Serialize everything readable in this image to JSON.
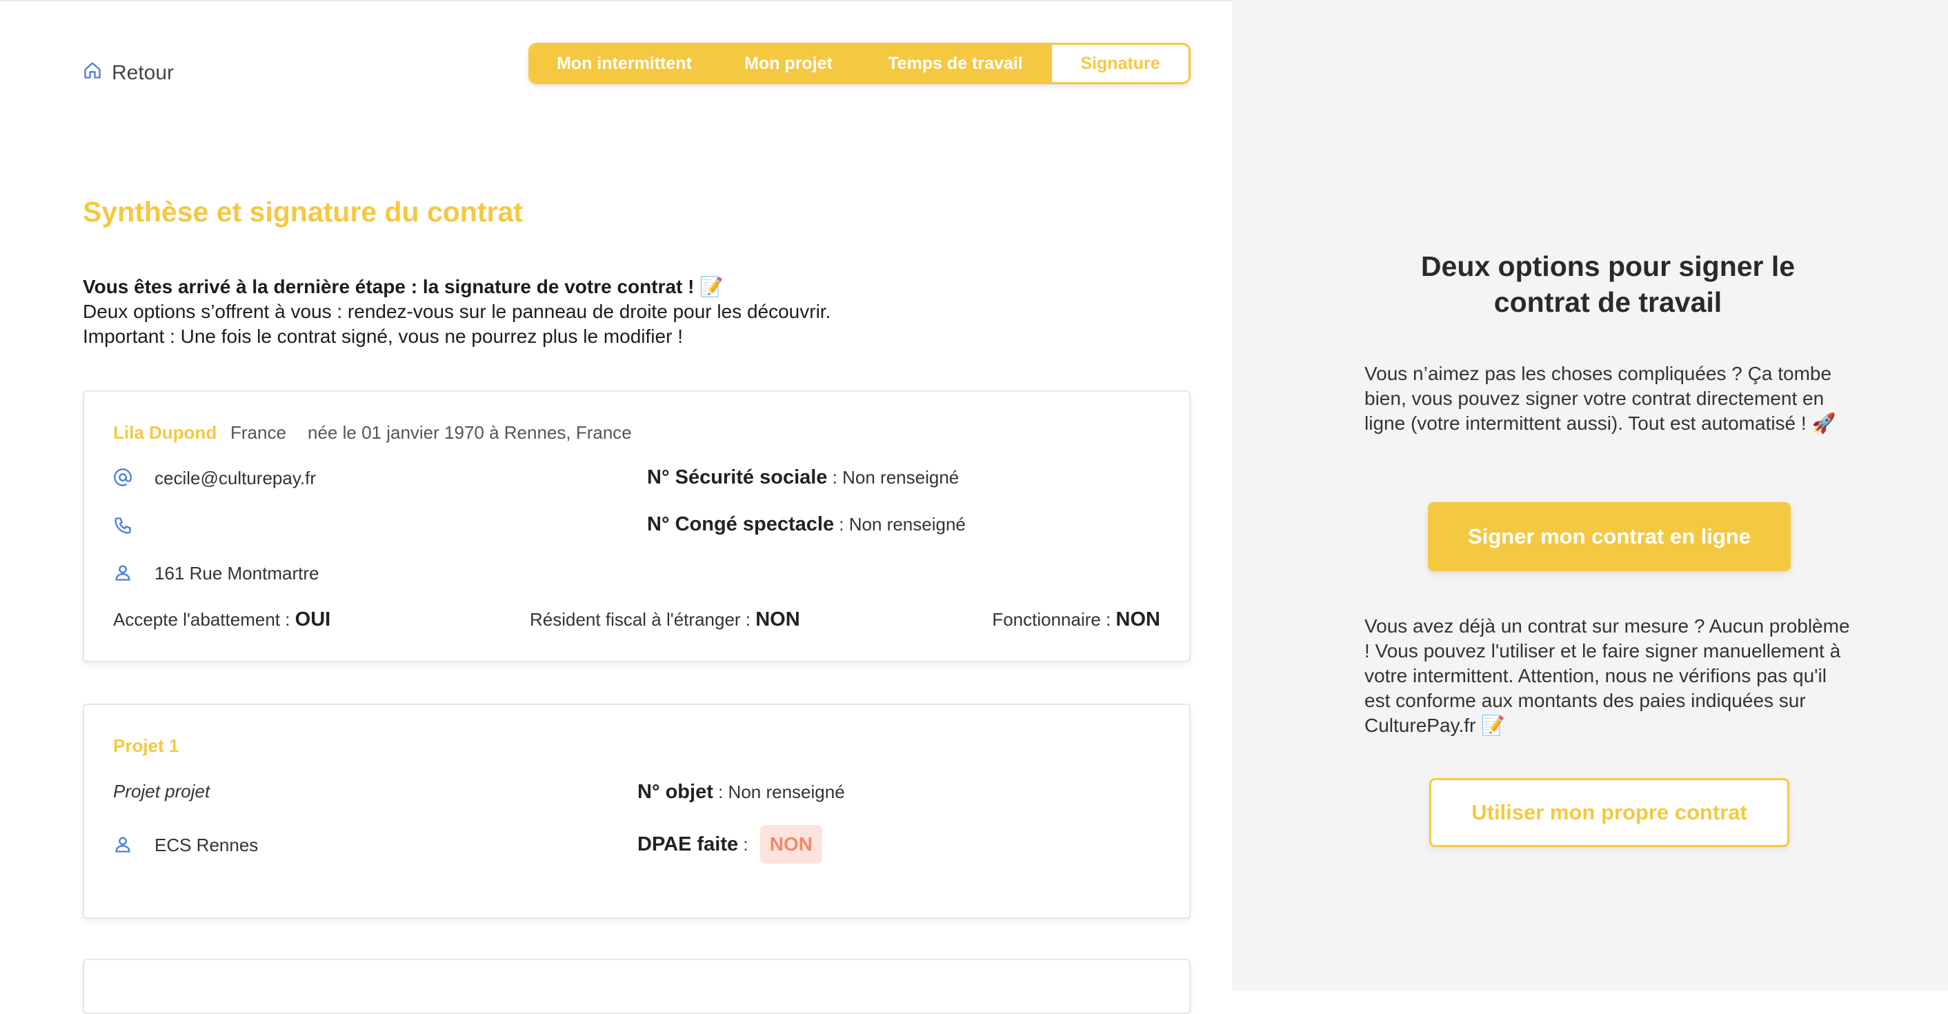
{
  "header": {
    "back_label": "Retour",
    "steps": [
      "Mon intermittent",
      "Mon projet",
      "Temps de travail",
      "Signature"
    ],
    "active_step": "Signature"
  },
  "main": {
    "title": "Synthèse et signature du contrat",
    "intro_bold": "Vous êtes arrivé à la dernière étape : la signature de votre contrat ! 📝",
    "intro_line2": "Deux options s’offrent à vous : rendez-vous sur le panneau de droite pour les découvrir.",
    "intro_line3": "Important : Une fois le contrat signé, vous ne pourrez plus le modifier !"
  },
  "person": {
    "name": "Lila Dupond",
    "country": "France",
    "birth": "née le 01 janvier 1970 à Rennes, France",
    "email": "cecile@culturepay.fr",
    "phone": "",
    "address": "161 Rue Montmartre",
    "ss_label": "N° Sécurité sociale",
    "ss_value": " : Non renseigné",
    "conge_label": "N° Congé spectacle",
    "conge_value": " : Non renseigné",
    "abattement_label": "Accepte l'abattement : ",
    "abattement_value": "OUI",
    "resident_label": "Résident fiscal à l'étranger : ",
    "resident_value": "NON",
    "fonctionnaire_label": "Fonctionnaire : ",
    "fonctionnaire_value": "NON"
  },
  "project": {
    "title": "Projet 1",
    "name": "Projet projet",
    "location": "ECS Rennes",
    "objet_label": "N° objet",
    "objet_value": " : Non renseigné",
    "dpae_label": "DPAE faite",
    "dpae_sep": " : ",
    "dpae_value": "NON"
  },
  "right_panel": {
    "title": "Deux options pour signer le contrat de travail",
    "text_online": "Vous n’aimez pas les choses compliquées ? Ça tombe bien, vous pouvez signer votre contrat directement en ligne (votre intermittent aussi). Tout est automatisé ! 🚀",
    "btn_online": "Signer mon contrat en ligne",
    "text_own": "Vous avez déjà un contrat sur mesure ? Aucun problème ! Vous pouvez l'utiliser et le faire signer manuellement à votre intermittent. Attention, nous ne vérifions pas qu'il est conforme aux montants des paies indiquées sur CulturePay.fr 📝",
    "btn_own": "Utiliser mon propre contrat"
  },
  "colors": {
    "accent": "#f5c842",
    "badge_bg": "#fde3dc",
    "badge_text": "#f08a6e",
    "icon_blue": "#4a7fd6",
    "panel_bg": "#f4f4f4"
  },
  "icons": {
    "back": "home-icon",
    "email": "at-icon",
    "phone": "phone-icon",
    "address": "location-person-icon"
  }
}
